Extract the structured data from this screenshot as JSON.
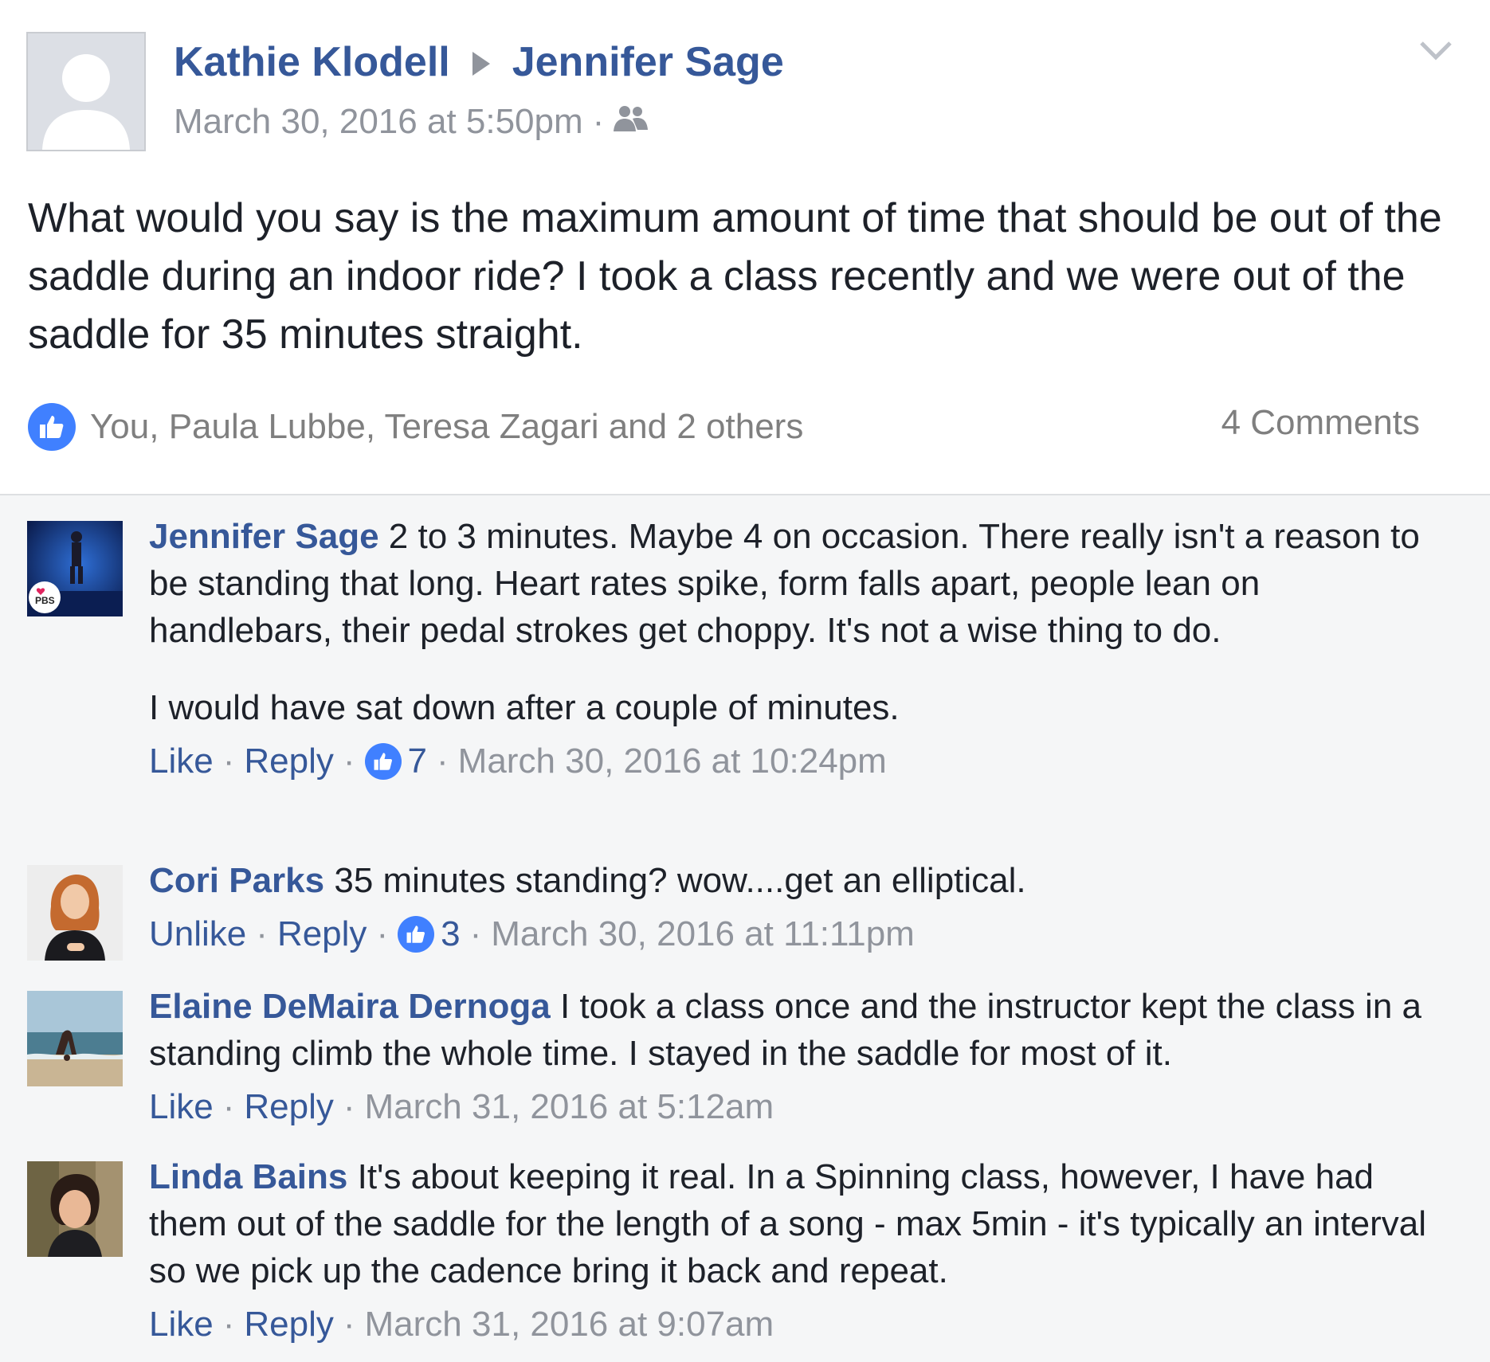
{
  "post": {
    "author": "Kathie Klodell",
    "target": "Jennifer Sage",
    "timestamp": "March 30, 2016 at 5:50pm",
    "audience_icon": "group-icon",
    "text": "What would you say is the maximum amount of time that should be out of the saddle during an indoor ride? I took a class recently and we were out of the saddle for 35 minutes straight.",
    "likes_summary": "You, Paula Lubbe, Teresa Zagari and 2 others",
    "comments_count": "4 Comments"
  },
  "comments": [
    {
      "author": "Jennifer Sage",
      "text": "2 to 3 minutes. Maybe 4 on occasion. There really isn't a reason to be standing that long. Heart rates spike, form falls apart, people lean on handlebars, their pedal strokes get choppy. It's not a wise thing to do.",
      "text2": "I would have sat down after a couple of minutes.",
      "action": "Like",
      "reply": "Reply",
      "reactions": "7",
      "timestamp": "March 30, 2016 at 10:24pm",
      "avatar_badge": "PBS"
    },
    {
      "author": "Cori Parks",
      "text": "35 minutes standing? wow....get an elliptical.",
      "action": "Unlike",
      "reply": "Reply",
      "reactions": "3",
      "timestamp": "March 30, 2016 at 11:11pm"
    },
    {
      "author": "Elaine DeMaira Dernoga",
      "text": "I took a class once and the instructor kept the class in a standing climb the whole time. I stayed in the saddle for most of it.",
      "action": "Like",
      "reply": "Reply",
      "timestamp": "March 31, 2016 at 5:12am"
    },
    {
      "author": "Linda Bains",
      "text": "It's about keeping it real. In a Spinning class, however, I have had them out of the saddle for the length of a song - max 5min - it's typically an interval so we pick up the cadence bring it back and repeat.",
      "action": "Like",
      "reply": "Reply",
      "timestamp": "March 31, 2016 at 9:07am"
    }
  ],
  "colors": {
    "link": "#365899",
    "meta": "#90949c",
    "like_blue": "#4080ff",
    "comments_bg": "#f5f6f7"
  }
}
